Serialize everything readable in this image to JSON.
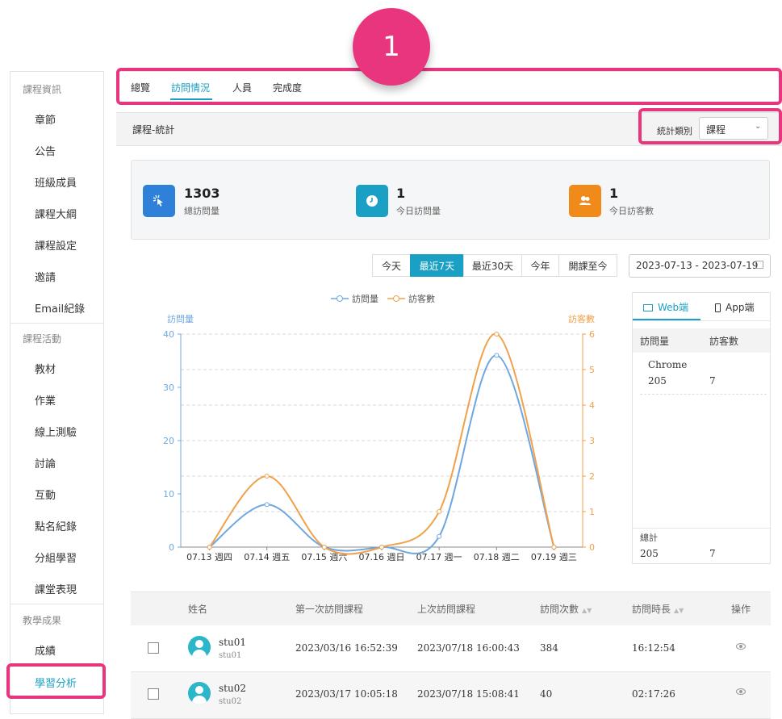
{
  "sidebar": {
    "sections": [
      {
        "title": "課程資訊",
        "items": [
          "章節",
          "公告",
          "班級成員",
          "課程大綱",
          "課程設定",
          "邀請",
          "Email紀錄"
        ]
      },
      {
        "title": "課程活動",
        "items": [
          "教材",
          "作業",
          "線上測驗",
          "討論",
          "互動",
          "點名紀錄",
          "分組學習",
          "課堂表現"
        ]
      },
      {
        "title": "教學成果",
        "items": [
          "成績",
          "學習分析"
        ]
      }
    ],
    "active": "學習分析"
  },
  "badge": "1",
  "tabs": [
    "總覽",
    "訪問情況",
    "人員",
    "完成度"
  ],
  "active_tab": "訪問情況",
  "panel": {
    "title": "課程-統計",
    "filter_label": "統計類別",
    "filter_value": "課程"
  },
  "stats": [
    {
      "value": "1303",
      "label": "總訪問量",
      "icon": "pointer-click-icon",
      "color": "#2f80d8"
    },
    {
      "value": "1",
      "label": "今日訪問量",
      "icon": "clock-icon",
      "color": "#1aa0c4"
    },
    {
      "value": "1",
      "label": "今日訪客數",
      "icon": "users-icon",
      "color": "#f08a1b"
    }
  ],
  "range_buttons": [
    "今天",
    "最近7天",
    "最近30天",
    "今年",
    "開課至今"
  ],
  "active_range": "最近7天",
  "date_range": "2023-07-13 - 2023-07-19",
  "chart_data": {
    "type": "line",
    "categories": [
      "07.13 週四",
      "07.14 週五",
      "07.15 週六",
      "07.16 週日",
      "07.17 週一",
      "07.18 週二",
      "07.19 週三"
    ],
    "series": [
      {
        "name": "訪問量",
        "axis": "left",
        "color": "#6ea7e0",
        "values": [
          0,
          8,
          0,
          0,
          2,
          36,
          0
        ]
      },
      {
        "name": "訪客數",
        "axis": "right",
        "color": "#f0a14a",
        "values": [
          0,
          2,
          0,
          0,
          1,
          6,
          0
        ]
      }
    ],
    "ylabel": "訪問量",
    "ylabel_right": "訪客數",
    "ylim": [
      0,
      40
    ],
    "yticks": [
      0,
      10,
      20,
      30,
      40
    ],
    "ylim_right": [
      0,
      6
    ],
    "yticks_right": [
      0,
      1,
      2,
      3,
      4,
      5,
      6
    ],
    "grid": true,
    "legend_position": "top"
  },
  "side_card": {
    "tabs": [
      "Web端",
      "App端"
    ],
    "active_tab": "Web端",
    "columns": [
      "訪問量",
      "訪客數"
    ],
    "browser": "Chrome",
    "browser_values": [
      "205",
      "7"
    ],
    "total_label": "總計",
    "total_values": [
      "205",
      "7"
    ]
  },
  "table": {
    "columns": [
      "姓名",
      "第一次訪問課程",
      "上次訪問課程",
      "訪問次數",
      "訪問時長",
      "操作"
    ],
    "rows": [
      {
        "name": "stu01",
        "account": "stu01",
        "first": "2023/03/16 16:52:39",
        "last": "2023/07/18 16:00:43",
        "count": "384",
        "duration": "16:12:54"
      },
      {
        "name": "stu02",
        "account": "stu02",
        "first": "2023/03/17 10:05:18",
        "last": "2023/07/18 15:08:41",
        "count": "40",
        "duration": "02:17:26"
      }
    ]
  }
}
